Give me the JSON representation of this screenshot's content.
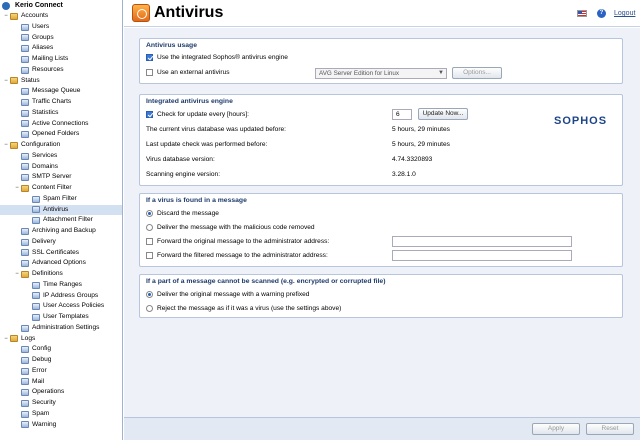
{
  "sidebar": {
    "title": "Kerio Connect",
    "items": [
      {
        "label": "Accounts",
        "level": 0,
        "type": "folder",
        "toggle": "−"
      },
      {
        "label": "Users",
        "level": 1,
        "type": "item"
      },
      {
        "label": "Groups",
        "level": 1,
        "type": "item"
      },
      {
        "label": "Aliases",
        "level": 1,
        "type": "item"
      },
      {
        "label": "Mailing Lists",
        "level": 1,
        "type": "item"
      },
      {
        "label": "Resources",
        "level": 1,
        "type": "item"
      },
      {
        "label": "Status",
        "level": 0,
        "type": "folder",
        "toggle": "−"
      },
      {
        "label": "Message Queue",
        "level": 1,
        "type": "item"
      },
      {
        "label": "Traffic Charts",
        "level": 1,
        "type": "item"
      },
      {
        "label": "Statistics",
        "level": 1,
        "type": "item"
      },
      {
        "label": "Active Connections",
        "level": 1,
        "type": "item"
      },
      {
        "label": "Opened Folders",
        "level": 1,
        "type": "item"
      },
      {
        "label": "Configuration",
        "level": 0,
        "type": "folder",
        "toggle": "−"
      },
      {
        "label": "Services",
        "level": 1,
        "type": "item"
      },
      {
        "label": "Domains",
        "level": 1,
        "type": "item"
      },
      {
        "label": "SMTP Server",
        "level": 1,
        "type": "item"
      },
      {
        "label": "Content Filter",
        "level": 1,
        "type": "folder",
        "toggle": "−"
      },
      {
        "label": "Spam Filter",
        "level": 2,
        "type": "item"
      },
      {
        "label": "Antivirus",
        "level": 2,
        "type": "item",
        "selected": true
      },
      {
        "label": "Attachment Filter",
        "level": 2,
        "type": "item"
      },
      {
        "label": "Archiving and Backup",
        "level": 1,
        "type": "item"
      },
      {
        "label": "Delivery",
        "level": 1,
        "type": "item"
      },
      {
        "label": "SSL Certificates",
        "level": 1,
        "type": "item"
      },
      {
        "label": "Advanced Options",
        "level": 1,
        "type": "item"
      },
      {
        "label": "Definitions",
        "level": 1,
        "type": "folder",
        "toggle": "−"
      },
      {
        "label": "Time Ranges",
        "level": 2,
        "type": "item"
      },
      {
        "label": "IP Address Groups",
        "level": 2,
        "type": "item"
      },
      {
        "label": "User Access Policies",
        "level": 2,
        "type": "item"
      },
      {
        "label": "User Templates",
        "level": 2,
        "type": "item"
      },
      {
        "label": "Administration Settings",
        "level": 1,
        "type": "item"
      },
      {
        "label": "Logs",
        "level": 0,
        "type": "folder",
        "toggle": "−"
      },
      {
        "label": "Config",
        "level": 1,
        "type": "item"
      },
      {
        "label": "Debug",
        "level": 1,
        "type": "item"
      },
      {
        "label": "Error",
        "level": 1,
        "type": "item"
      },
      {
        "label": "Mail",
        "level": 1,
        "type": "item"
      },
      {
        "label": "Operations",
        "level": 1,
        "type": "item"
      },
      {
        "label": "Security",
        "level": 1,
        "type": "item"
      },
      {
        "label": "Spam",
        "level": 1,
        "type": "item"
      },
      {
        "label": "Warning",
        "level": 1,
        "type": "item"
      }
    ]
  },
  "header": {
    "title": "Antivirus",
    "help_glyph": "?",
    "logout_label": "Logout"
  },
  "usage": {
    "legend": "Antivirus usage",
    "integrated_label": "Use the integrated Sophos® antivirus engine",
    "external_label": "Use an external antivirus",
    "external_select_value": "AVG Server Edition for Linux",
    "options_button": "Options..."
  },
  "engine": {
    "legend": "Integrated antivirus engine",
    "check_update_label": "Check for update every [hours]:",
    "check_update_value": "6",
    "update_now_button": "Update Now...",
    "brand": "SOPHOS",
    "rows": [
      {
        "label": "The current virus database was updated before:",
        "value": "5 hours, 29 minutes"
      },
      {
        "label": "Last update check was performed before:",
        "value": "5 hours, 29 minutes"
      },
      {
        "label": "Virus database version:",
        "value": "4.74.3320893"
      },
      {
        "label": "Scanning engine version:",
        "value": "3.28.1.0"
      }
    ]
  },
  "virus_found": {
    "legend": "If a virus is found in a message",
    "discard_label": "Discard the message",
    "deliver_removed_label": "Deliver the message with the malicious code removed",
    "forward_original_label": "Forward the original message to the administrator address:",
    "forward_filtered_label": "Forward the filtered message to the administrator address:"
  },
  "cannot_scan": {
    "legend": "If a part of a message cannot be scanned (e.g. encrypted or corrupted file)",
    "deliver_warning_label": "Deliver the original message with a warning prefixed",
    "reject_label": "Reject the message as if it was a virus (use the settings above)"
  },
  "footer": {
    "apply_button": "Apply",
    "reset_button": "Reset"
  }
}
